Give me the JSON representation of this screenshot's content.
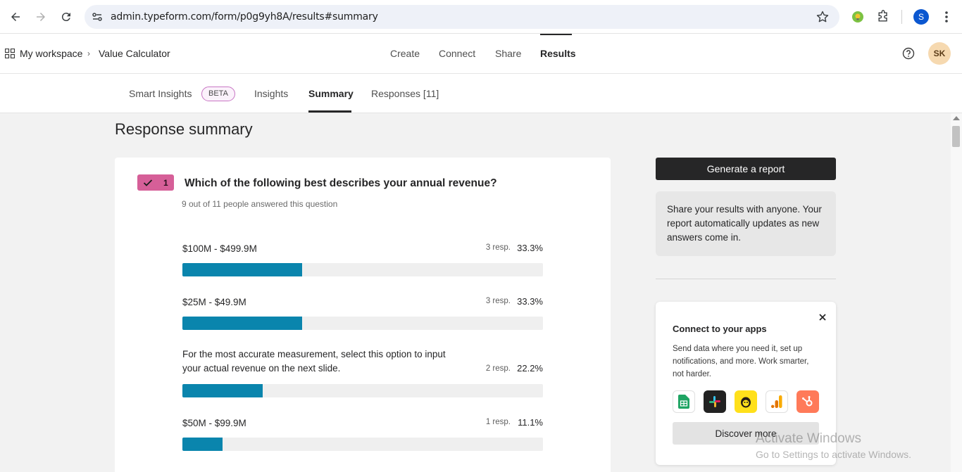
{
  "browser": {
    "url": "admin.typeform.com/form/p0g9yh8A/results#summary",
    "profile_initial": "S"
  },
  "app": {
    "breadcrumb": [
      "My workspace",
      "Value Calculator"
    ],
    "top_nav": [
      "Create",
      "Connect",
      "Share",
      "Results"
    ],
    "active_top_nav": "Results",
    "avatar_initials": "SK"
  },
  "subtabs": {
    "items": [
      "Smart Insights",
      "Insights",
      "Summary",
      "Responses [11]"
    ],
    "beta_label": "BETA",
    "active": "Summary"
  },
  "main": {
    "page_title": "Response summary",
    "question": {
      "number": "1",
      "title": "Which of the following best describes your annual revenue?",
      "subtitle": "9 out of 11 people answered this question",
      "options": [
        {
          "label": "$100M - $499.9M",
          "resp": "3 resp.",
          "pct": "33.3%",
          "fraction": 0.333
        },
        {
          "label": "$25M - $49.9M",
          "resp": "3 resp.",
          "pct": "33.3%",
          "fraction": 0.333
        },
        {
          "label": "For the most accurate measurement, select this option to input your actual revenue on the next slide.",
          "resp": "2 resp.",
          "pct": "22.2%",
          "fraction": 0.222
        },
        {
          "label": "$50M - $99.9M",
          "resp": "1 resp.",
          "pct": "11.1%",
          "fraction": 0.111
        }
      ]
    }
  },
  "sidebar": {
    "generate_label": "Generate a report",
    "share_text": "Share your results with anyone. Your report automatically updates as new answers come in.",
    "connect": {
      "title": "Connect to your apps",
      "description": "Send data where you need it, set up notifications, and more. Work smarter, not harder.",
      "apps": [
        "google-sheets-icon",
        "slack-icon",
        "mailchimp-icon",
        "google-analytics-icon",
        "hubspot-icon"
      ],
      "discover_label": "Discover more"
    }
  },
  "watermark": {
    "line1": "Activate Windows",
    "line2": "Go to Settings to activate Windows."
  },
  "colors": {
    "bar": "#0a85ad",
    "badge": "#d65f98",
    "dark": "#262627"
  }
}
